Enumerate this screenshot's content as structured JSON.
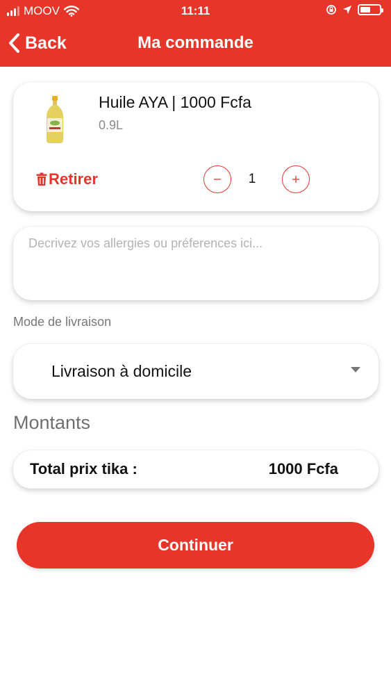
{
  "status_bar": {
    "carrier": "MOOV",
    "time": "11:11",
    "battery_level": 0.55
  },
  "nav": {
    "back_label": "Back",
    "title": "Ma commande"
  },
  "product": {
    "name": "Huile AYA | 1000 Fcfa",
    "size": "0.9L",
    "remove_label": "Retirer",
    "quantity": "1",
    "thumbnail_icon": "oil-bottle-icon"
  },
  "notes": {
    "placeholder": "Decrivez vos allergies ou préferences ici..."
  },
  "delivery": {
    "label": "Mode de livraison",
    "selected": "Livraison à domicile"
  },
  "amounts": {
    "title": "Montants",
    "total_label": "Total prix tika :",
    "total_value": "1000 Fcfa"
  },
  "actions": {
    "continue_label": "Continuer"
  },
  "colors": {
    "brand_red": "#e8352a",
    "muted_text": "#8a8a8a"
  }
}
